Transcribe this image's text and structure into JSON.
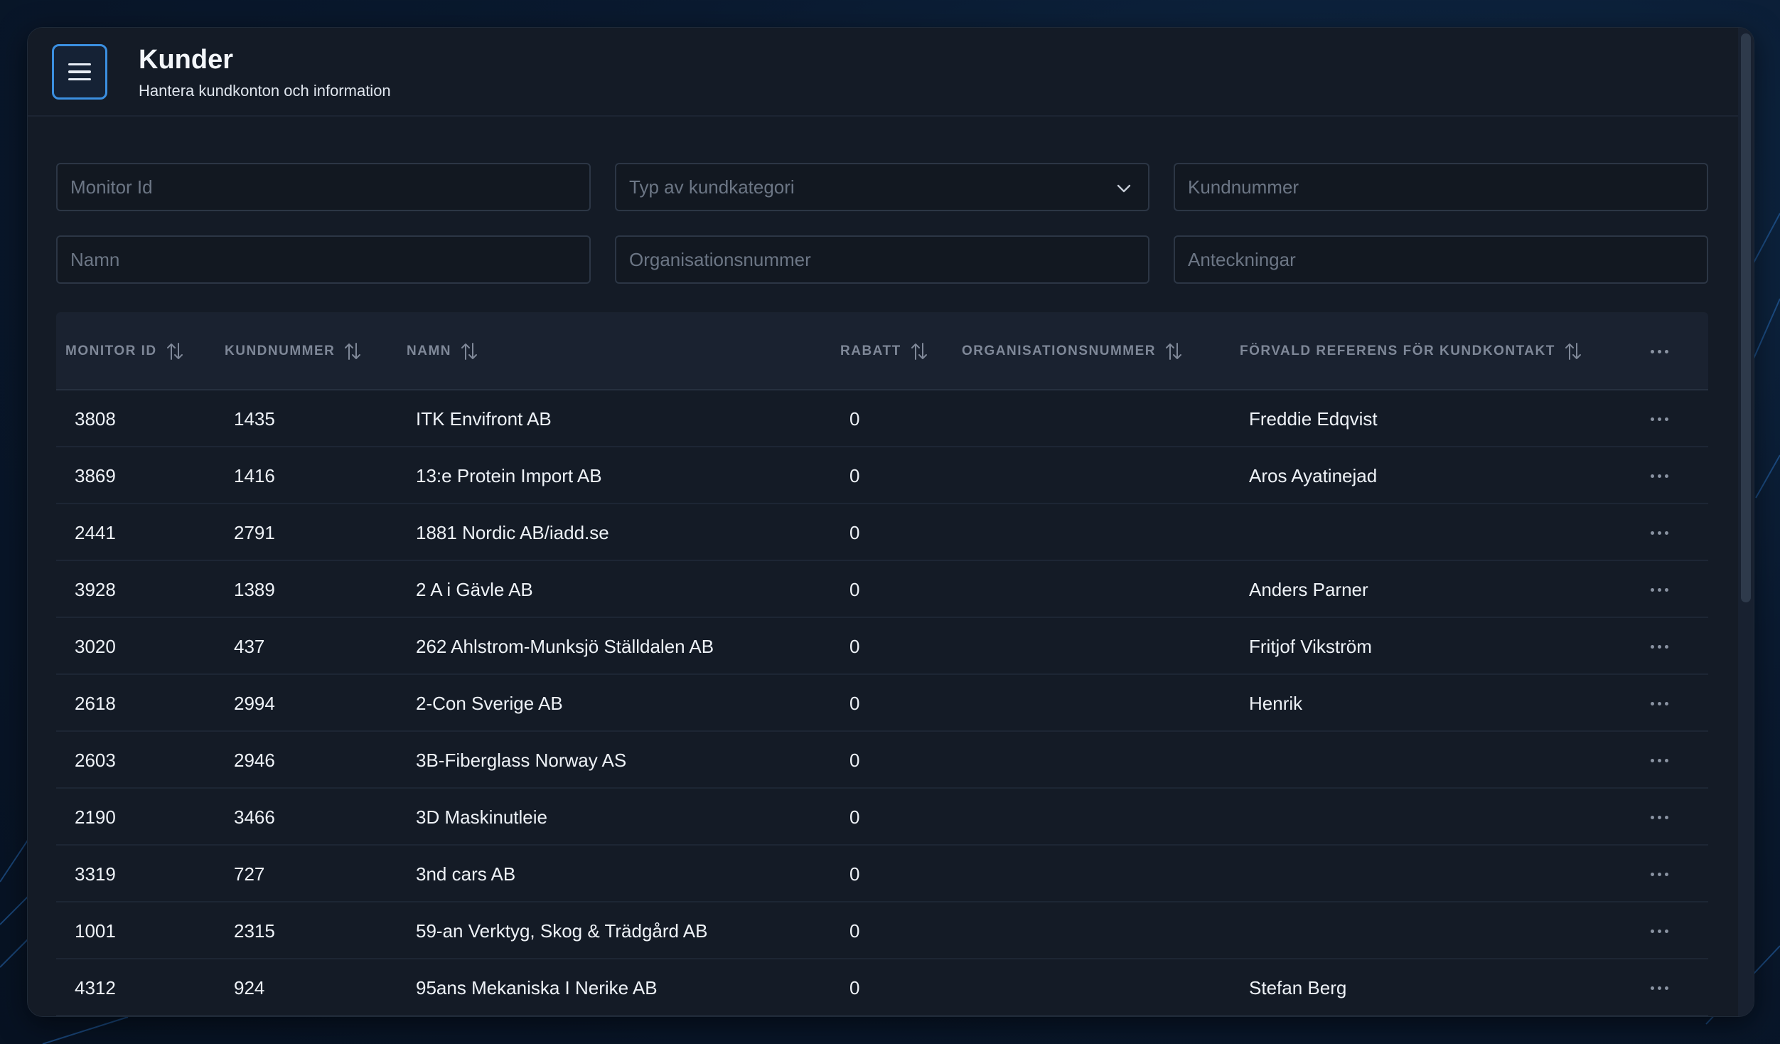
{
  "header": {
    "title": "Kunder",
    "subtitle": "Hantera kundkonton och information"
  },
  "filters": {
    "monitor_id": "Monitor Id",
    "kundkategori": "Typ av kundkategori",
    "kundnummer": "Kundnummer",
    "namn": "Namn",
    "organisationsnummer": "Organisationsnummer",
    "anteckningar": "Anteckningar"
  },
  "table": {
    "columns": {
      "monitor_id": "MONITOR ID",
      "kundnummer": "KUNDNUMMER",
      "namn": "NAMN",
      "rabatt": "RABATT",
      "organisationsnummer": "ORGANISATIONSNUMMER",
      "referens": "FÖRVALD REFERENS FÖR KUNDKONTAKT"
    },
    "rows": [
      {
        "monitor_id": "3808",
        "kundnummer": "1435",
        "namn": "ITK Envifront AB",
        "rabatt": "0",
        "org": "",
        "ref": "Freddie Edqvist"
      },
      {
        "monitor_id": "3869",
        "kundnummer": "1416",
        "namn": "13:e Protein Import AB",
        "rabatt": "0",
        "org": "",
        "ref": "Aros Ayatinejad"
      },
      {
        "monitor_id": "2441",
        "kundnummer": "2791",
        "namn": "1881 Nordic AB/iadd.se",
        "rabatt": "0",
        "org": "",
        "ref": ""
      },
      {
        "monitor_id": "3928",
        "kundnummer": "1389",
        "namn": "2 A i Gävle AB",
        "rabatt": "0",
        "org": "",
        "ref": "Anders Parner"
      },
      {
        "monitor_id": "3020",
        "kundnummer": "437",
        "namn": "262 Ahlstrom-Munksjö Ställdalen AB",
        "rabatt": "0",
        "org": "",
        "ref": "Fritjof Vikström"
      },
      {
        "monitor_id": "2618",
        "kundnummer": "2994",
        "namn": "2-Con Sverige AB",
        "rabatt": "0",
        "org": "",
        "ref": "Henrik"
      },
      {
        "monitor_id": "2603",
        "kundnummer": "2946",
        "namn": "3B-Fiberglass Norway AS",
        "rabatt": "0",
        "org": "",
        "ref": ""
      },
      {
        "monitor_id": "2190",
        "kundnummer": "3466",
        "namn": "3D Maskinutleie",
        "rabatt": "0",
        "org": "",
        "ref": ""
      },
      {
        "monitor_id": "3319",
        "kundnummer": "727",
        "namn": "3nd cars AB",
        "rabatt": "0",
        "org": "",
        "ref": ""
      },
      {
        "monitor_id": "1001",
        "kundnummer": "2315",
        "namn": "59-an Verktyg, Skog & Trädgård AB",
        "rabatt": "0",
        "org": "",
        "ref": ""
      },
      {
        "monitor_id": "4312",
        "kundnummer": "924",
        "namn": "95ans Mekaniska I Nerike AB",
        "rabatt": "0",
        "org": "",
        "ref": "Stefan Berg"
      }
    ]
  },
  "icons": {
    "menu": "hamburger-menu-icon",
    "chevron": "chevron-down-icon",
    "sort": "sort-arrows-icon",
    "more": "more-horizontal-icon"
  },
  "colors": {
    "accent": "#3b8fe0",
    "panel": "#141b26",
    "background": "#0a1a30"
  }
}
